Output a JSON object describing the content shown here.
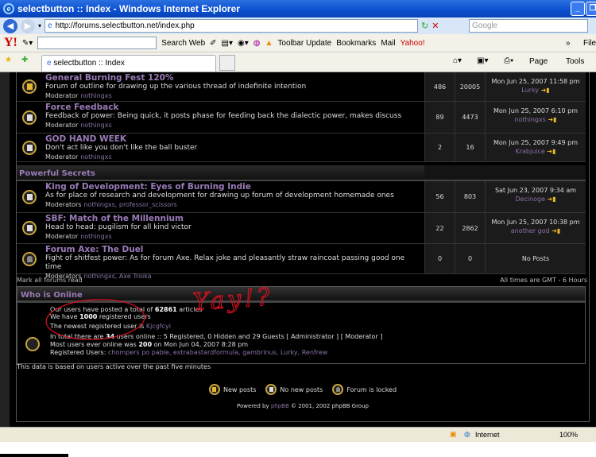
{
  "window": {
    "title": "selectbutton :: Index - Windows Internet Explorer"
  },
  "address": {
    "url": "http://forums.selectbutton.net/index.php",
    "search_placeholder": "Google"
  },
  "ytoolbar": {
    "logo": "Y!",
    "search_web": "Search Web",
    "toolbar_update": "Toolbar Update",
    "bookmarks": "Bookmarks",
    "mail": "Mail",
    "yahoo": "Yahoo!",
    "more": "»",
    "file": "File"
  },
  "tabs": {
    "active": "selectbutton :: Index",
    "page": "Page",
    "tools": "Tools"
  },
  "forums": [
    {
      "name": "General Burning Fest 120%",
      "desc": "Forum of outline for drawing up the various thread of indefinite intention",
      "mod_label": "Moderator",
      "mods": "nothingxs",
      "topics": "486",
      "posts": "20005",
      "last_date": "Mon Jun 25, 2007 11:58 pm",
      "last_user": "Lurky",
      "icon": "new"
    },
    {
      "name": "Force Feedback",
      "desc": "Feedback of power: Being quick, it posts phase for feeding back the dialectic power, makes discuss",
      "mod_label": "Moderator",
      "mods": "nothingxs",
      "topics": "89",
      "posts": "4473",
      "last_date": "Mon Jun 25, 2007 6:10 pm",
      "last_user": "nothingxs",
      "icon": "old"
    },
    {
      "name": "GOD HAND WEEK",
      "desc": "Don't act like you don't like the ball buster",
      "mod_label": "Moderator",
      "mods": "nothingxs",
      "topics": "2",
      "posts": "16",
      "last_date": "Mon Jun 25, 2007 9:49 pm",
      "last_user": "Krabjuice",
      "icon": "old"
    }
  ],
  "category": "Powerful Secrets",
  "forums2": [
    {
      "name": "King of Development: Eyes of Burning Indie",
      "desc": "As for place of research and development for drawing up forum of development homemade ones",
      "mod_label": "Moderators",
      "mods": "nothingxs, professor_scissors",
      "topics": "56",
      "posts": "803",
      "last_date": "Sat Jun 23, 2007 9:34 am",
      "last_user": "Decinoge",
      "icon": "old"
    },
    {
      "name": "SBF: Match of the Millennium",
      "desc": "Head to head: pugilism for all kind victor",
      "mod_label": "Moderator",
      "mods": "nothingxs",
      "topics": "22",
      "posts": "2862",
      "last_date": "Mon Jun 25, 2007 10:38 pm",
      "last_user": "another god",
      "icon": "old"
    },
    {
      "name": "Forum Axe: The Duel",
      "desc": "Fight of shitfest power: As for forum Axe. Relax joke and pleasantly straw raincoat passing good one time",
      "mod_label": "Moderators",
      "mods": "nothingxs, Axe Troika",
      "topics": "0",
      "posts": "0",
      "last_date": "No Posts",
      "last_user": "",
      "icon": "lock"
    }
  ],
  "mark_read": "Mark all forums read",
  "timezone": "All times are GMT - 6 Hours",
  "who": {
    "title": "Who is Online",
    "l1a": "Our users have posted a total of ",
    "l1b": "62861",
    "l1c": " articles",
    "l2a": "We have ",
    "l2b": "1000",
    "l2c": " registered users",
    "l3a": "The newest registered user is ",
    "l3b": "Kjcgfcyi",
    "l4a": "In total there are ",
    "l4b": "34",
    "l4c": " users online :: 5 Registered, 0 Hidden and 29 Guests   [ Administrator ]   [ Moderator ]",
    "l5a": "Most users ever online was ",
    "l5b": "200",
    "l5c": " on Mon Jun 04, 2007 8:28 pm",
    "l6a": "Registered Users: ",
    "l6b": "chompers po pable, extrabastardformula, gambrinus, Lurky, Renfrew"
  },
  "active_note": "This data is based on users active over the past five minutes",
  "legend": {
    "new": "New posts",
    "old": "No new posts",
    "lock": "Forum is locked"
  },
  "powered": {
    "a": "Powered by ",
    "b": "phpBB",
    "c": " © 2001, 2002 phpBB Group"
  },
  "status": {
    "zone": "Internet",
    "zoom": "100%"
  },
  "annotation": "Yay!?",
  "colors": {
    "link": "#9a7bb8",
    "annotation": "#e01020"
  }
}
